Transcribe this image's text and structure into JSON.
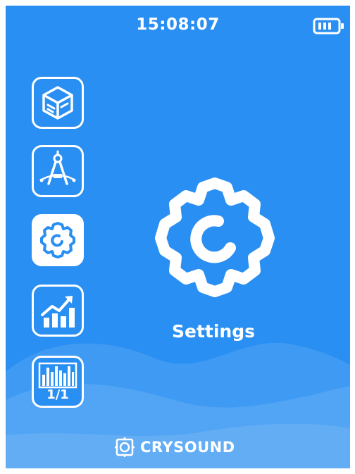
{
  "status_bar": {
    "time": "15:08:07",
    "battery_icon": "battery-icon"
  },
  "sidebar": {
    "items": [
      {
        "icon": "box-3d-icon",
        "active": false
      },
      {
        "icon": "compass-measure-icon",
        "active": false
      },
      {
        "icon": "gear-icon",
        "active": true
      },
      {
        "icon": "chart-trend-icon",
        "active": false
      },
      {
        "icon": "octave-band-icon",
        "active": false,
        "sublabel": "1/1"
      }
    ]
  },
  "main": {
    "current_icon": "settings-gear-icon",
    "current_label": "Settings"
  },
  "footer": {
    "brand_icon": "crysound-logo-icon",
    "brand": "CRYSOUND"
  },
  "colors": {
    "background": "#2a8ff2",
    "foreground": "#ffffff"
  }
}
